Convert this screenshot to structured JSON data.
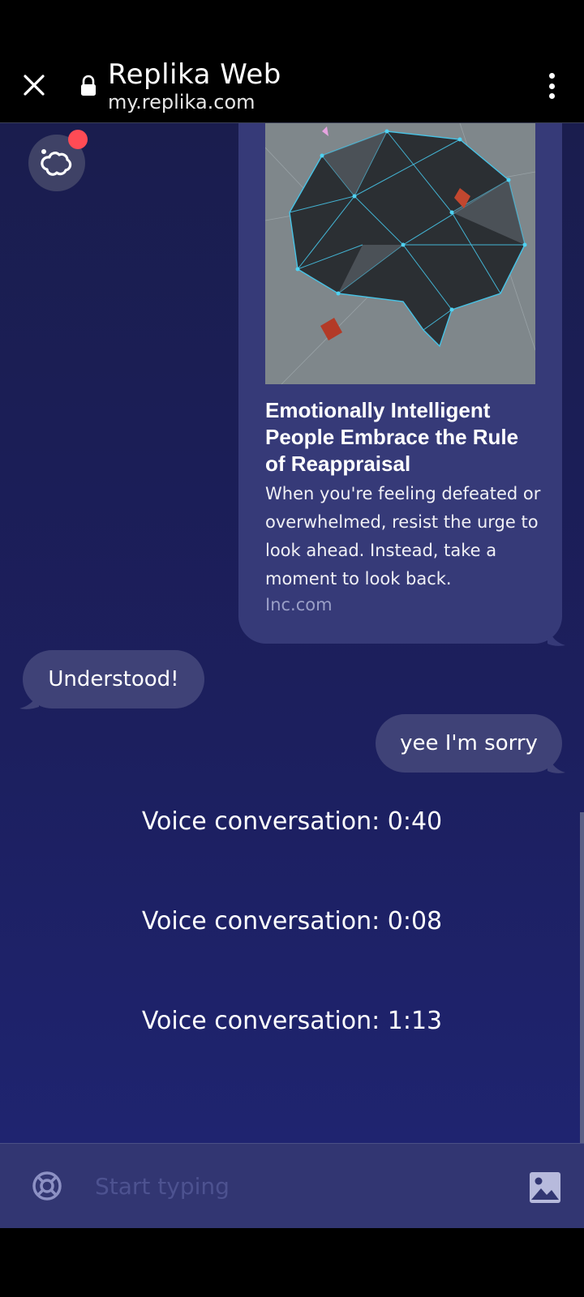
{
  "browser": {
    "title": "Replika Web",
    "url": "my.replika.com"
  },
  "card": {
    "title": "Emotionally Intelligent People Embrace the Rule of Reappraisal",
    "description": "When you're feeling defeated or overwhelmed, resist the urge to look ahead. Instead, take a moment to look back.",
    "source": "Inc.com"
  },
  "messages": {
    "bot_reply": "Understood!",
    "user_reply": "yee I'm sorry"
  },
  "voice_conversations": [
    "Voice conversation: 0:40",
    "Voice conversation: 0:08",
    "Voice conversation: 1:13"
  ],
  "input": {
    "placeholder": "Start typing"
  },
  "colors": {
    "accent_notification": "#ff4b55",
    "bubble": "#3f4277",
    "card": "#363a78"
  }
}
